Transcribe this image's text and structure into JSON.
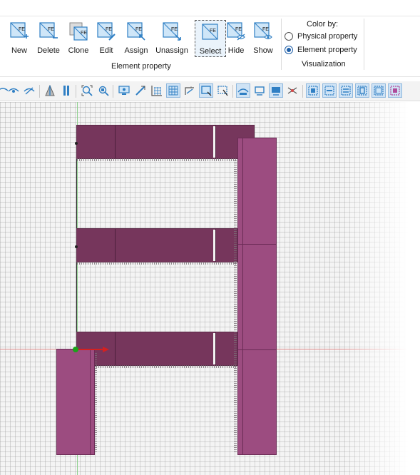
{
  "ribbon": {
    "buttons": [
      {
        "id": "new",
        "label": "New",
        "icon": "fe-new-icon"
      },
      {
        "id": "delete",
        "label": "Delete",
        "icon": "fe-delete-icon"
      },
      {
        "id": "clone",
        "label": "Clone",
        "icon": "fe-clone-icon"
      },
      {
        "id": "edit",
        "label": "Edit",
        "icon": "fe-edit-icon"
      },
      {
        "id": "assign",
        "label": "Assign",
        "icon": "fe-assign-icon"
      },
      {
        "id": "unassign",
        "label": "Unassign",
        "icon": "fe-unassign-icon"
      },
      {
        "id": "select",
        "label": "Select",
        "icon": "fe-select-icon",
        "selected": true
      },
      {
        "id": "hide",
        "label": "Hide",
        "icon": "fe-hide-icon"
      },
      {
        "id": "show",
        "label": "Show",
        "icon": "fe-show-icon"
      }
    ],
    "icon_text": "FE",
    "element_property_group": "Element property",
    "color_by": {
      "title": "Color by:",
      "options": [
        {
          "label": "Physical property",
          "checked": false
        },
        {
          "label": "Element property",
          "checked": true
        }
      ],
      "group_label": "Visualization"
    }
  },
  "colors": {
    "beam": "#76365c",
    "column": "#9c4c80",
    "icon_blue": "#2f7fc4",
    "axis_x": "#d42020",
    "axis_origin": "#1aa31a"
  }
}
